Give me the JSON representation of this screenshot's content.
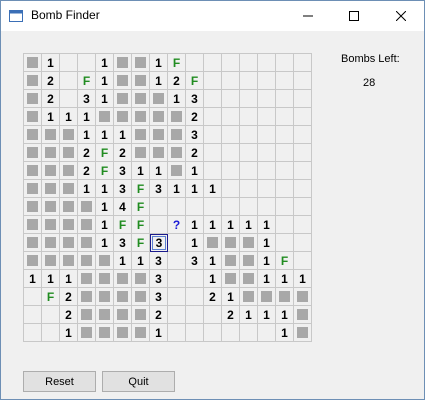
{
  "window": {
    "title": "Bomb Finder"
  },
  "status": {
    "bombs_left_label": "Bombs Left:",
    "bombs_left_value": "28"
  },
  "buttons": {
    "reset": "Reset",
    "quit": "Quit"
  },
  "board": {
    "rows": [
      [
        "H",
        "1",
        "",
        "",
        "1",
        "H",
        "H",
        "1",
        "F",
        "",
        "",
        "",
        "",
        "",
        "",
        ""
      ],
      [
        "H",
        "2",
        "",
        "F",
        "1",
        "H",
        "H",
        "1",
        "2",
        "F",
        "",
        "",
        "",
        "",
        "",
        ""
      ],
      [
        "H",
        "2",
        "",
        "3",
        "1",
        "H",
        "H",
        "H",
        "1",
        "3",
        "",
        "",
        "",
        "",
        "",
        ""
      ],
      [
        "H",
        "1",
        "1",
        "1",
        "H",
        "H",
        "H",
        "H",
        "H",
        "2",
        "",
        "",
        "",
        "",
        "",
        ""
      ],
      [
        "H",
        "H",
        "H",
        "1",
        "1",
        "1",
        "H",
        "H",
        "H",
        "3",
        "",
        "",
        "",
        "",
        "",
        ""
      ],
      [
        "H",
        "H",
        "H",
        "2",
        "F",
        "2",
        "H",
        "H",
        "H",
        "2",
        "",
        "",
        "",
        "",
        "",
        ""
      ],
      [
        "H",
        "H",
        "H",
        "2",
        "F",
        "3",
        "1",
        "1",
        "H",
        "1",
        "",
        "",
        "",
        "",
        "",
        ""
      ],
      [
        "H",
        "H",
        "H",
        "1",
        "1",
        "3",
        "F",
        "3",
        "1",
        "1",
        "1",
        "",
        "",
        "",
        "",
        ""
      ],
      [
        "H",
        "H",
        "H",
        "H",
        "1",
        "4",
        "F",
        "",
        "",
        "",
        "",
        "",
        "",
        "",
        "",
        ""
      ],
      [
        "H",
        "H",
        "H",
        "H",
        "1",
        "F",
        "F",
        "",
        "?",
        "1",
        "1",
        "1",
        "1",
        "1",
        "",
        ""
      ],
      [
        "H",
        "H",
        "H",
        "H",
        "1",
        "3",
        "F",
        "3",
        "",
        "1",
        "H",
        "H",
        "H",
        "1",
        "",
        ""
      ],
      [
        "H",
        "H",
        "H",
        "H",
        "H",
        "1",
        "1",
        "3",
        "",
        "3",
        "1",
        "H",
        "H",
        "1",
        "F",
        ""
      ],
      [
        "1",
        "1",
        "1",
        "H",
        "H",
        "H",
        "H",
        "3",
        "",
        "",
        "1",
        "H",
        "H",
        "1",
        "1",
        "1"
      ],
      [
        "",
        "F",
        "2",
        "H",
        "H",
        "H",
        "H",
        "3",
        "",
        "",
        "2",
        "1",
        "H",
        "H",
        "H",
        "H"
      ],
      [
        "",
        "",
        "2",
        "H",
        "H",
        "H",
        "H",
        "2",
        "",
        "",
        "",
        "2",
        "1",
        "1",
        "1",
        "H"
      ],
      [
        "",
        "",
        "1",
        "H",
        "H",
        "H",
        "H",
        "1",
        "",
        "",
        "",
        "",
        "",
        "",
        "1",
        "H"
      ]
    ],
    "selected_cell": {
      "row": 10,
      "col": 7
    },
    "colors": {
      "hidden": "#a8a8a8",
      "flag": "#218c21",
      "question": "#1a1ad6"
    }
  },
  "icons": {
    "app": "form-window-icon",
    "minimize": "minimize-icon",
    "maximize": "maximize-icon",
    "close": "close-icon"
  }
}
